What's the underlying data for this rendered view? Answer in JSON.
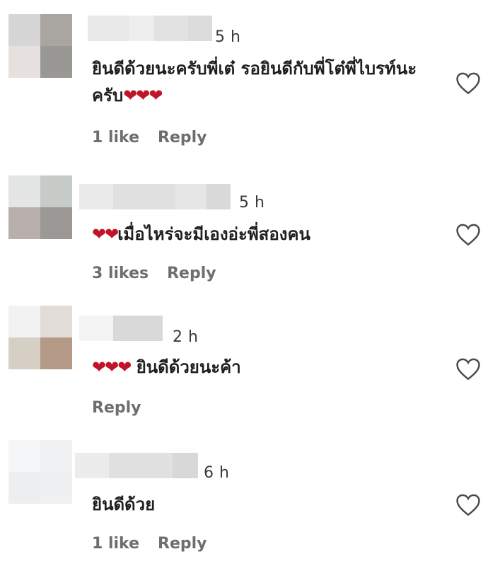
{
  "comments": [
    {
      "time": "5 h",
      "text": "ยินดีด้วยนะครับพี่เต๋ รอยินดีกับพี่โต๋พี่ไบรท์นะครับ",
      "hearts": "❤❤❤",
      "likes": "1 like",
      "reply": "Reply",
      "avatar_colors": [
        "#d6d6d6",
        "#a9a6a2",
        "#e6e0de",
        "#9a9895"
      ],
      "blur_colors": [
        "#e8e8e8",
        "#eeeeee",
        "#e2e2e2",
        "#dcdcdc"
      ]
    },
    {
      "time": "5 h",
      "text": "เมื่อไหร่จะมีเองอ่ะพี่สองคน",
      "hearts": "❤❤",
      "likes": "3 likes",
      "reply": "Reply",
      "avatar_colors": [
        "#e3e6e4",
        "#c6cbc7",
        "#b8aeac",
        "#9c9895"
      ],
      "blur_colors": [
        "#eaeaea",
        "#e0e0e0",
        "#e6e6e6",
        "#d9d9d9"
      ]
    },
    {
      "time": "2 h",
      "text": "ยินดีด้วยนะค้า",
      "hearts": "❤❤❤",
      "likes": "",
      "reply": "Reply",
      "avatar_colors": [
        "#f2f2f2",
        "#e2dcd8",
        "#d6cfc6",
        "#b59a87"
      ],
      "blur_colors": [
        "#f4f4f4",
        "#d9d9d9"
      ]
    },
    {
      "time": "6 h",
      "text": "ยินดีด้วย",
      "hearts": "",
      "likes": "1 like",
      "reply": "Reply",
      "avatar_colors": [
        "#f5f6f7",
        "#f0f1f3",
        "#eceef0",
        "#eef0f2"
      ],
      "blur_colors": [
        "#ececec",
        "#e1e1e1",
        "#d8d8d8"
      ]
    }
  ]
}
